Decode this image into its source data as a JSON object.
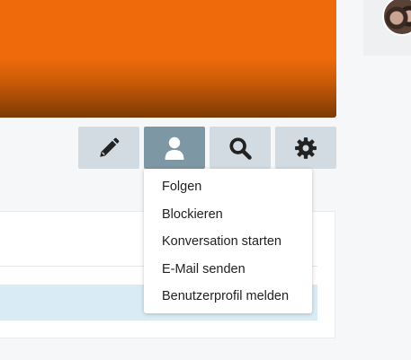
{
  "header": {
    "accent_color": "#ee6a0b"
  },
  "actions": {
    "edit": {
      "icon": "pencil-icon"
    },
    "profile": {
      "icon": "user-icon",
      "active": true
    },
    "search": {
      "icon": "search-icon"
    },
    "settings": {
      "icon": "gear-icon"
    }
  },
  "profile_menu": {
    "items": [
      {
        "label": "Folgen"
      },
      {
        "label": "Blockieren"
      },
      {
        "label": "Konversation starten"
      },
      {
        "label": "E-Mail senden"
      },
      {
        "label": "Benutzerprofil melden"
      }
    ]
  },
  "colors": {
    "button_bg": "#d3dbe2",
    "button_active_bg": "#7e97a4",
    "highlight_row": "#d9ecf5"
  }
}
